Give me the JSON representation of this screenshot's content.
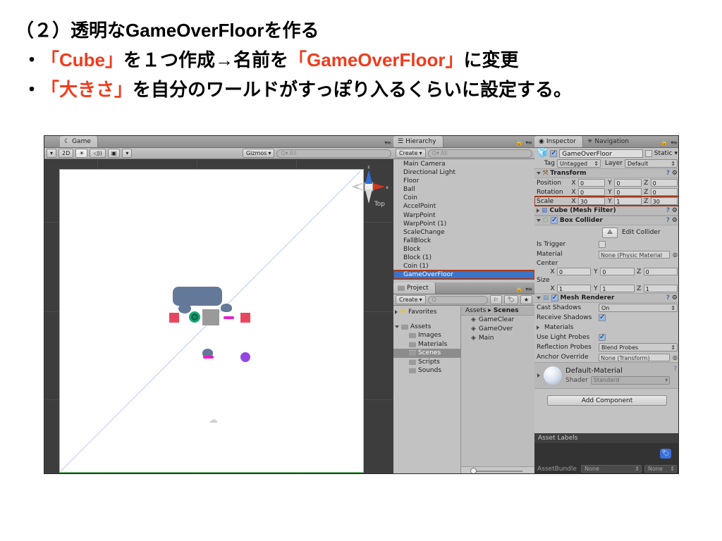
{
  "slide": {
    "title_line": "（２）透明なGameOverFloorを作る",
    "bullets": [
      {
        "pre": "・",
        "parts": [
          {
            "t": "「Cube」",
            "em": true
          },
          {
            "t": "を１つ作成→名前を",
            "em": false
          },
          {
            "t": "「GameOverFloor」",
            "em": true
          },
          {
            "t": "に変更",
            "em": false
          }
        ]
      },
      {
        "pre": "・",
        "parts": [
          {
            "t": "「大きさ」",
            "em": true
          },
          {
            "t": "を自分のワールドがすっぽり入るくらいに設定する。",
            "em": false
          }
        ]
      }
    ],
    "accent_color": "#f03c1e"
  },
  "scene_view": {
    "tab_label": "Game",
    "toolbar": {
      "draw_mode_arrow": "▾",
      "two_d_label": "2D",
      "lighting_icon": "sun-icon",
      "audio_icon": "speaker-icon",
      "fx_icon": "image-icon",
      "fx_arrow": "▾",
      "gizmos_label": "Gizmos",
      "gizmos_arrow": "▾",
      "search_placeholder": "All"
    },
    "gizmo": {
      "view_label": "Top",
      "axis_z": "z",
      "axis_x": "x",
      "z_color": "#2f6fd8",
      "x_color": "#d8331b",
      "y_color": "#d8d8d8"
    },
    "selection_outline_color": "#7ddb82",
    "objects": [
      {
        "name": "gameoverfloor-cube",
        "kind": "selected-cube"
      },
      {
        "name": "floor-slab",
        "kind": "slab"
      },
      {
        "name": "ball",
        "kind": "coin-ring"
      },
      {
        "name": "block-left",
        "kind": "pink-block"
      },
      {
        "name": "block-right",
        "kind": "pink-block"
      },
      {
        "name": "fallblock",
        "kind": "gray-block"
      },
      {
        "name": "warppoint-1",
        "kind": "warp"
      },
      {
        "name": "warppoint-2",
        "kind": "warp"
      },
      {
        "name": "coin-purple",
        "kind": "purple-ball"
      },
      {
        "name": "main-camera-gizmo",
        "kind": "cloud"
      }
    ]
  },
  "hierarchy": {
    "tab_label": "Hierarchy",
    "create_label": "Create",
    "create_arrow": "▾",
    "search_placeholder": "All",
    "items": [
      {
        "label": "Main Camera",
        "selected": false
      },
      {
        "label": "Directional Light",
        "selected": false
      },
      {
        "label": "Floor",
        "selected": false
      },
      {
        "label": "Ball",
        "selected": false
      },
      {
        "label": "Coin",
        "selected": false
      },
      {
        "label": "AccelPoint",
        "selected": false
      },
      {
        "label": "WarpPoint",
        "selected": false
      },
      {
        "label": "WarpPoint (1)",
        "selected": false
      },
      {
        "label": "ScaleChange",
        "selected": false
      },
      {
        "label": "FallBlock",
        "selected": false
      },
      {
        "label": "Block",
        "selected": false
      },
      {
        "label": "Block (1)",
        "selected": false
      },
      {
        "label": "Coin (1)",
        "selected": false
      },
      {
        "label": "GameOverFloor",
        "selected": true
      }
    ]
  },
  "project": {
    "tab_label": "Project",
    "create_label": "Create",
    "create_arrow": "▾",
    "search_placeholder": "",
    "favorites_label": "Favorites",
    "assets_label": "Assets",
    "folders": [
      {
        "label": "Images",
        "selected": false
      },
      {
        "label": "Materials",
        "selected": false
      },
      {
        "label": "Scenes",
        "selected": true
      },
      {
        "label": "Scripts",
        "selected": false
      },
      {
        "label": "Sounds",
        "selected": false
      }
    ],
    "breadcrumb": [
      "Assets",
      "Scenes"
    ],
    "breadcrumb_sep": "▸",
    "assets": [
      {
        "label": "GameClear"
      },
      {
        "label": "GameOver"
      },
      {
        "label": "Main"
      }
    ]
  },
  "inspector": {
    "tab_label": "Inspector",
    "tab_label_2": "Navigation",
    "object_name": "GameOverFloor",
    "enabled": true,
    "static_label": "Static",
    "static_checked": false,
    "static_arrow": "▾",
    "tag_label": "Tag",
    "tag_value": "Untagged",
    "layer_label": "Layer",
    "layer_value": "Default",
    "transform": {
      "title": "Transform",
      "rows": [
        {
          "label": "Position",
          "x": "0",
          "y": "0",
          "z": "0",
          "highlight": false
        },
        {
          "label": "Rotation",
          "x": "0",
          "y": "0",
          "z": "0",
          "highlight": false
        },
        {
          "label": "Scale",
          "x": "30",
          "y": "1",
          "z": "30",
          "highlight": true
        }
      ],
      "axes": [
        "X",
        "Y",
        "Z"
      ]
    },
    "mesh_filter": {
      "title": "Cube (Mesh Filter)"
    },
    "box_collider": {
      "title": "Box Collider",
      "enabled": true,
      "edit_collider_label": "Edit Collider",
      "is_trigger_label": "Is Trigger",
      "is_trigger_checked": false,
      "material_label": "Material",
      "material_value": "None (Physic Material",
      "center_label": "Center",
      "center": {
        "x": "0",
        "y": "0",
        "z": "0"
      },
      "size_label": "Size",
      "size": {
        "x": "1",
        "y": "1",
        "z": "1"
      },
      "axes": [
        "X",
        "Y",
        "Z"
      ]
    },
    "mesh_renderer": {
      "title": "Mesh Renderer",
      "enabled": true,
      "rows": [
        {
          "label": "Cast Shadows",
          "type": "dropdown",
          "value": "On"
        },
        {
          "label": "Receive Shadows",
          "type": "checkbox",
          "checked": true
        },
        {
          "label": "Materials",
          "type": "foldout",
          "value": ""
        },
        {
          "label": "Use Light Probes",
          "type": "checkbox",
          "checked": true
        },
        {
          "label": "Reflection Probes",
          "type": "dropdown",
          "value": "Blend Probes"
        },
        {
          "label": "Anchor Override",
          "type": "objfield",
          "value": "None (Transform)"
        }
      ]
    },
    "material_preview": {
      "name": "Default-Material",
      "shader_label": "Shader",
      "shader_value": "Standard"
    },
    "add_component_label": "Add Component",
    "asset_labels_title": "Asset Labels",
    "assetbundle_label": "AssetBundle",
    "assetbundle_value": "None",
    "assetbundle_variant": "None",
    "dropdown_arrow": "⇕",
    "highlight_color": "#a33a1e",
    "selection_color": "#3a74c9"
  }
}
